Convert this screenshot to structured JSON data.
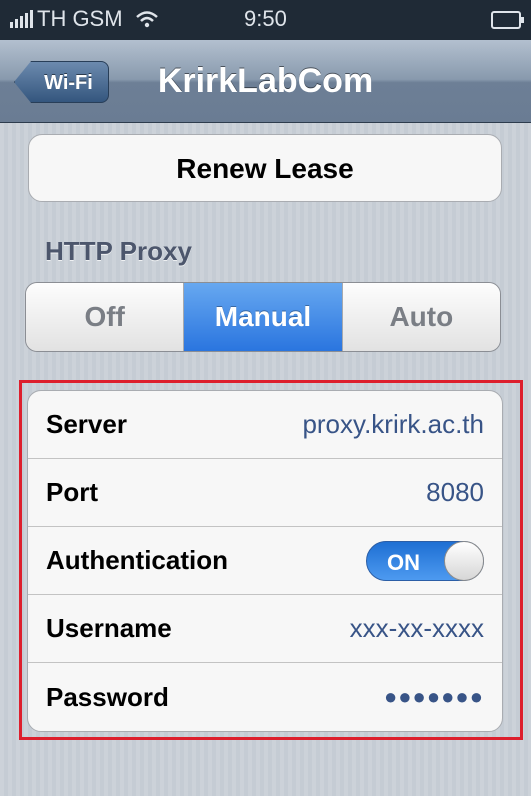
{
  "status_bar": {
    "carrier": "TH GSM",
    "time": "9:50"
  },
  "nav": {
    "back_label": "Wi-Fi",
    "title": "KrirkLabCom"
  },
  "renew_lease": {
    "label": "Renew Lease"
  },
  "http_proxy": {
    "section_label": "HTTP Proxy",
    "options": [
      "Off",
      "Manual",
      "Auto"
    ],
    "selected": "Manual"
  },
  "proxy_fields": {
    "server": {
      "label": "Server",
      "value": "proxy.krirk.ac.th"
    },
    "port": {
      "label": "Port",
      "value": "8080"
    },
    "authentication": {
      "label": "Authentication",
      "toggle_text": "ON",
      "enabled": true
    },
    "username": {
      "label": "Username",
      "value": "xxx-xx-xxxx"
    },
    "password": {
      "label": "Password",
      "value": "●●●●●●●"
    }
  },
  "colors": {
    "accent": "#2a75df",
    "highlight_border": "#dd1f2d",
    "value_text": "#385487"
  }
}
